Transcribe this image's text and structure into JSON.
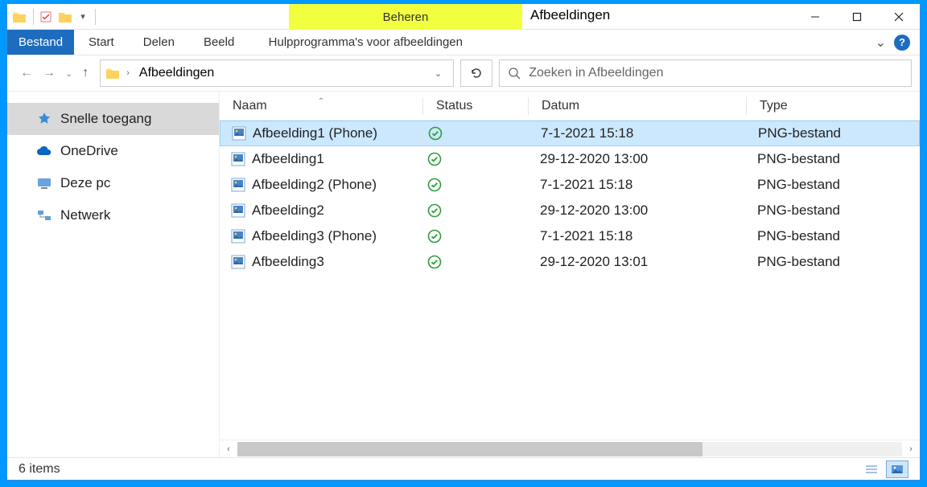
{
  "window": {
    "title": "Afbeeldingen"
  },
  "titlebar": {
    "context_top": "Beheren"
  },
  "ribbon": {
    "file": "Bestand",
    "home": "Start",
    "share": "Delen",
    "view": "Beeld",
    "context": "Hulpprogramma's voor afbeeldingen"
  },
  "address": {
    "crumb1": "Afbeeldingen"
  },
  "search": {
    "placeholder": "Zoeken in Afbeeldingen"
  },
  "navpane": {
    "quick": "Snelle toegang",
    "onedrive": "OneDrive",
    "thispc": "Deze pc",
    "network": "Netwerk"
  },
  "columns": {
    "name": "Naam",
    "status": "Status",
    "date": "Datum",
    "type": "Type"
  },
  "files": [
    {
      "name": "Afbeelding1 (Phone)",
      "date": "7-1-2021 15:18",
      "type": "PNG-bestand",
      "selected": true
    },
    {
      "name": "Afbeelding1",
      "date": "29-12-2020 13:00",
      "type": "PNG-bestand",
      "selected": false
    },
    {
      "name": "Afbeelding2 (Phone)",
      "date": "7-1-2021 15:18",
      "type": "PNG-bestand",
      "selected": false
    },
    {
      "name": "Afbeelding2",
      "date": "29-12-2020 13:00",
      "type": "PNG-bestand",
      "selected": false
    },
    {
      "name": "Afbeelding3 (Phone)",
      "date": "7-1-2021 15:18",
      "type": "PNG-bestand",
      "selected": false
    },
    {
      "name": "Afbeelding3",
      "date": "29-12-2020 13:01",
      "type": "PNG-bestand",
      "selected": false
    }
  ],
  "statusbar": {
    "items": "6 items"
  }
}
